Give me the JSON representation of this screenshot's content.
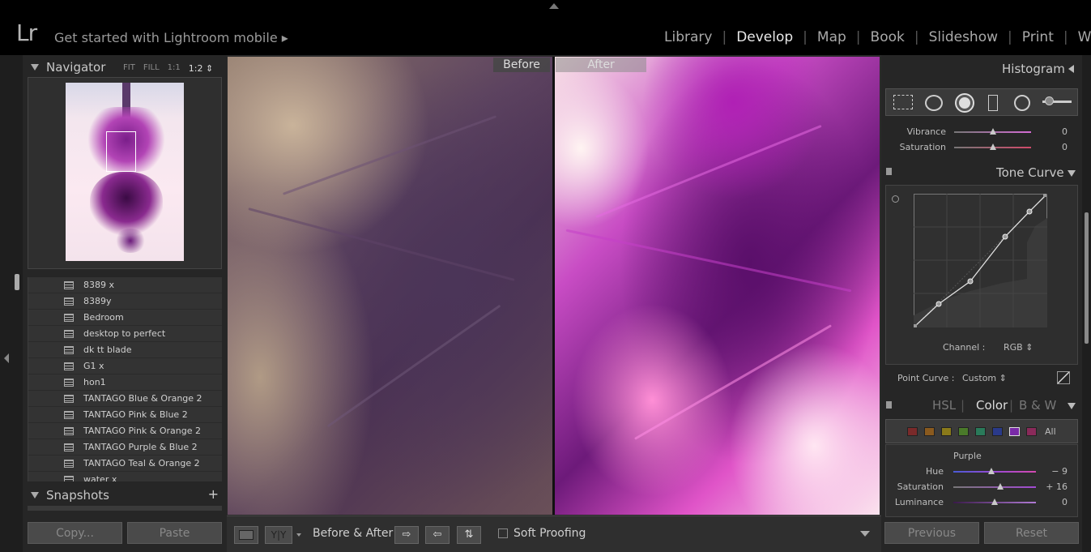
{
  "topbar": {
    "logo": "Lr",
    "mobile_link": "Get started with Lightroom mobile ▸",
    "modules": [
      "Library",
      "Develop",
      "Map",
      "Book",
      "Slideshow",
      "Print",
      "Web"
    ],
    "active_module": "Develop"
  },
  "navigator": {
    "title": "Navigator",
    "zoom_fit": "FIT",
    "zoom_fill": "FILL",
    "zoom_1_1": "1:1",
    "zoom_current": "1:2 ⇕"
  },
  "presets": [
    "8389 x",
    "8389y",
    "Bedroom",
    "desktop to perfect",
    "dk tt blade",
    "G1 x",
    "hon1",
    "TANTAGO Blue & Orange 2",
    "TANTAGO Pink & Blue 2",
    "TANTAGO Pink & Orange 2",
    "TANTAGO Purple & Blue 2",
    "TANTAGO Teal & Orange 2",
    "water x"
  ],
  "snapshots": {
    "title": "Snapshots",
    "add": "+"
  },
  "left_buttons": {
    "copy": "Copy...",
    "paste": "Paste"
  },
  "view": {
    "before_label": "Before",
    "after_label": "After"
  },
  "toolbar": {
    "yy_label": "Y|Y",
    "before_after_label": "Before & After :",
    "soft_proofing": "Soft Proofing"
  },
  "right_panel": {
    "histogram_title": "Histogram",
    "vibrance": {
      "label": "Vibrance",
      "value": "0"
    },
    "saturation": {
      "label": "Saturation",
      "value": "0"
    },
    "tone_curve_title": "Tone Curve",
    "channel_label": "Channel :",
    "channel_value": "RGB ⇕",
    "point_curve_label": "Point Curve :",
    "point_curve_value": "Custom ⇕",
    "hsl_tabs": {
      "hsl": "HSL",
      "color": "Color",
      "bw": "B & W"
    },
    "swatch_all": "All",
    "swatch_colors": [
      "#7a2a2a",
      "#8a5a1e",
      "#8a7a1a",
      "#4a7a2a",
      "#2a7a5a",
      "#2a3a8a",
      "#7a2aa8",
      "#8a2a5a"
    ],
    "color_section": "Purple",
    "hue": {
      "label": "Hue",
      "value": "− 9"
    },
    "hsl_saturation": {
      "label": "Saturation",
      "value": "+ 16"
    },
    "luminance": {
      "label": "Luminance",
      "value": "0"
    },
    "previous": "Previous",
    "reset": "Reset"
  }
}
